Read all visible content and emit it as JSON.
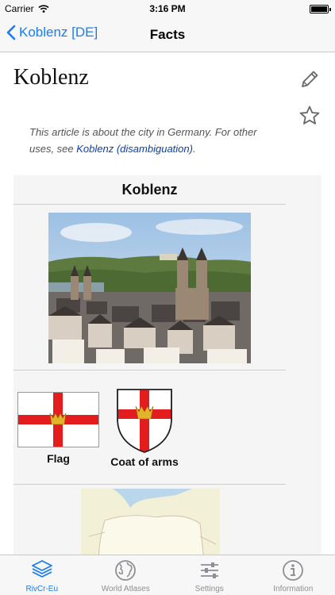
{
  "status_bar": {
    "carrier": "Carrier",
    "time": "3:16 PM"
  },
  "nav": {
    "back_label": "Koblenz [DE]",
    "title": "Facts"
  },
  "article": {
    "title": "Koblenz",
    "hatnote_text": "This article is about the city in Germany. For other uses, see ",
    "hatnote_link": "Koblenz (disambiguation)",
    "hatnote_end": "."
  },
  "infobox": {
    "title": "Koblenz",
    "flag_caption": "Flag",
    "coa_caption": "Coat of arms"
  },
  "tabs": [
    {
      "label": "RivCr-Eu",
      "icon": "layers-icon",
      "active": true
    },
    {
      "label": "World Atlases",
      "icon": "globe-icon",
      "active": false
    },
    {
      "label": "Settings",
      "icon": "sliders-icon",
      "active": false
    },
    {
      "label": "Information",
      "icon": "info-icon",
      "active": false
    }
  ],
  "colors": {
    "accent": "#1a7cf5",
    "link": "#0b3fa8",
    "flag_red": "#e31d1d",
    "flag_gold": "#e3b32a"
  }
}
